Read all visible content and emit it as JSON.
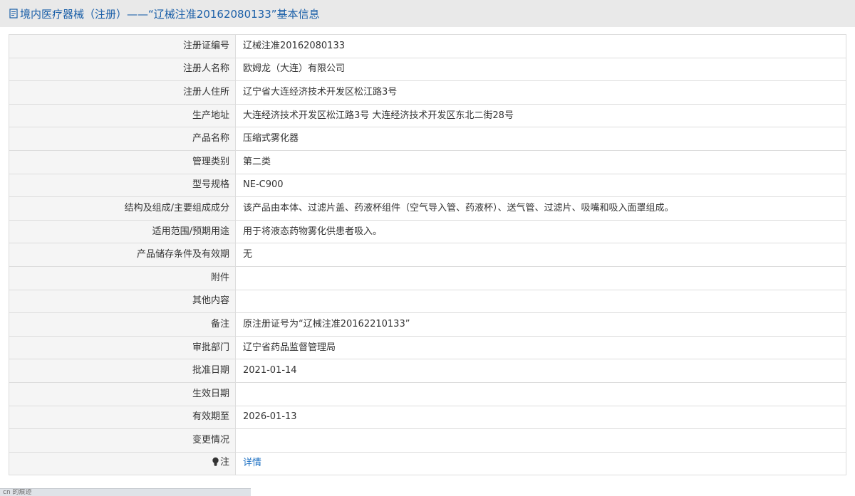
{
  "header": {
    "icon": "document-icon",
    "title": "境内医疗器械（注册）——“辽械注准20162080133”基本信息"
  },
  "rows": [
    {
      "key": "reg_no",
      "label": "注册证编号",
      "value": "辽械注准20162080133"
    },
    {
      "key": "registrant_name",
      "label": "注册人名称",
      "value": "欧姆龙（大连）有限公司"
    },
    {
      "key": "registrant_address",
      "label": "注册人住所",
      "value": "辽宁省大连经济技术开发区松江路3号"
    },
    {
      "key": "production_address",
      "label": "生产地址",
      "value": "大连经济技术开发区松江路3号 大连经济技术开发区东北二街28号"
    },
    {
      "key": "product_name",
      "label": "产品名称",
      "value": "压缩式雾化器"
    },
    {
      "key": "category",
      "label": "管理类别",
      "value": "第二类"
    },
    {
      "key": "model",
      "label": "型号规格",
      "value": "NE-C900"
    },
    {
      "key": "structure",
      "label": "结构及组成/主要组成成分",
      "value": "该产品由本体、过滤片盖、药液杯组件（空气导入管、药液杯）、送气管、过滤片、吸嘴和吸入面罩组成。"
    },
    {
      "key": "intended_use",
      "label": "适用范围/预期用途",
      "value": "用于将液态药物雾化供患者吸入。"
    },
    {
      "key": "storage",
      "label": "产品储存条件及有效期",
      "value": "无"
    },
    {
      "key": "attachment",
      "label": "附件",
      "value": ""
    },
    {
      "key": "other",
      "label": "其他内容",
      "value": ""
    },
    {
      "key": "remarks",
      "label": "备注",
      "value": "原注册证号为“辽械注准20162210133”"
    },
    {
      "key": "approval_dept",
      "label": "审批部门",
      "value": "辽宁省药品监督管理局"
    },
    {
      "key": "approval_date",
      "label": "批准日期",
      "value": "2021-01-14"
    },
    {
      "key": "effective_date",
      "label": "生效日期",
      "value": ""
    },
    {
      "key": "valid_until",
      "label": "有效期至",
      "value": "2026-01-13"
    },
    {
      "key": "changes",
      "label": "变更情况",
      "value": ""
    }
  ],
  "note_row": {
    "icon": "lightbulb-icon",
    "label": "注",
    "link_text": "详情"
  },
  "status_text": "cn 的痕迹"
}
